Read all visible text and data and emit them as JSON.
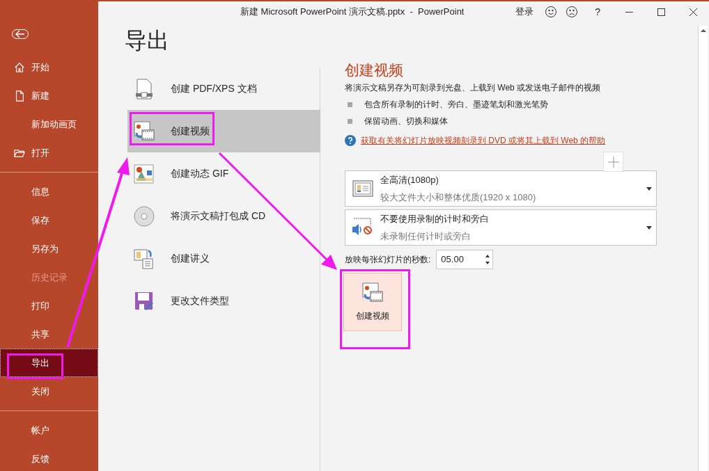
{
  "window": {
    "title": "新建 Microsoft PowerPoint 演示文稿.pptx  -  PowerPoint",
    "sign_in": "登录",
    "help": "?"
  },
  "sidebar": {
    "groups": [
      [
        {
          "label": "开始",
          "selected": false,
          "disabled": false
        },
        {
          "label": "新建",
          "selected": false,
          "disabled": false
        },
        {
          "label": "新加动画页",
          "selected": false,
          "disabled": false
        },
        {
          "label": "打开",
          "selected": false,
          "disabled": false
        }
      ],
      [
        {
          "label": "信息",
          "selected": false,
          "disabled": false
        },
        {
          "label": "保存",
          "selected": false,
          "disabled": false
        },
        {
          "label": "另存为",
          "selected": false,
          "disabled": false
        },
        {
          "label": "历史记录",
          "selected": false,
          "disabled": true
        },
        {
          "label": "打印",
          "selected": false,
          "disabled": false
        },
        {
          "label": "共享",
          "selected": false,
          "disabled": false
        },
        {
          "label": "导出",
          "selected": true,
          "disabled": false
        },
        {
          "label": "关闭",
          "selected": false,
          "disabled": false
        }
      ],
      [
        {
          "label": "帐户",
          "selected": false,
          "disabled": false
        },
        {
          "label": "反馈",
          "selected": false,
          "disabled": false
        }
      ]
    ]
  },
  "page_title": "导出",
  "export_options": [
    {
      "label": "创建 PDF/XPS 文档",
      "selected": false
    },
    {
      "label": "创建视频",
      "selected": true
    },
    {
      "label": "创建动态 GIF",
      "selected": false
    },
    {
      "label": "将演示文稿打包成 CD",
      "selected": false
    },
    {
      "label": "创建讲义",
      "selected": false
    },
    {
      "label": "更改文件类型",
      "selected": false
    }
  ],
  "detail": {
    "title": "创建视频",
    "description": "将演示文稿另存为可刻录到光盘、上载到 Web 或发送电子邮件的视频",
    "bullets": [
      "包含所有录制的计时、旁白、墨迹笔划和激光笔势",
      "保留动画、切换和媒体"
    ],
    "help_link": "获取有关将幻灯片放映视频刻录到 DVD 或将其上载到 Web 的帮助",
    "quality": {
      "title": "全高清(1080p)",
      "subtitle": "较大文件大小和整体优质(1920 x 1080)"
    },
    "narration": {
      "title": "不要使用录制的计时和旁白",
      "subtitle": "未录制任何计时或旁白"
    },
    "seconds": {
      "label": "放映每张幻灯片的秒数:",
      "value": "05.00"
    },
    "create_button": "创建视频"
  }
}
